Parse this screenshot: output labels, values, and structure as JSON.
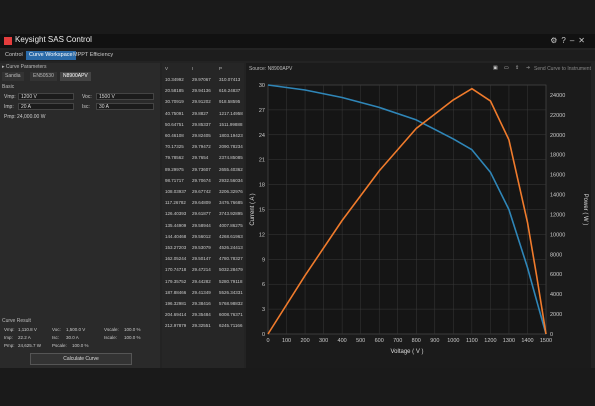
{
  "window": {
    "title": "Keysight SAS Control",
    "icons": [
      "gear-icon",
      "help-icon",
      "minimize-icon",
      "close-icon"
    ]
  },
  "tabs": [
    {
      "label": "Control",
      "active": false
    },
    {
      "label": "Curve Workspace",
      "active": true
    },
    {
      "label": "MPPT Efficiency",
      "active": false
    }
  ],
  "curve_params": {
    "section_label": "▸ Curve Parameters",
    "subtabs": [
      "Sandia",
      "EN50530",
      "N8900APV"
    ],
    "basic_label": "Basic",
    "vmp_label": "Vmp:",
    "vmp_value": "1200 V",
    "voc_label": "Voc:",
    "voc_value": "1500 V",
    "imp_label": "Imp:",
    "imp_value": "20 A",
    "isc_label": "Isc:",
    "isc_value": "30 A",
    "pmp_label": "Pmp: 24,000.00 W"
  },
  "curve_result": {
    "section_label": "Curve Result",
    "row1": [
      "Vmp:",
      "1,110.8 V",
      "Voc:",
      "1,500.0 V",
      "Vscale:",
      "100.0 %"
    ],
    "row2": [
      "Imp:",
      "22.2 A",
      "Isc:",
      "30.0 A",
      "Iscale:",
      "100.0 %"
    ],
    "row3": [
      "Pmp:",
      "24,625.7 W",
      "Pscale:",
      "100.0 %"
    ],
    "calculate_label": "Calculate Curve"
  },
  "table": {
    "headers": [
      "V",
      "I",
      "P"
    ],
    "rows": [
      [
        "10.34992",
        "29.97067",
        "310.07413"
      ],
      [
        "20.58185",
        "29.94136",
        "616.24837"
      ],
      [
        "30.70919",
        "29.91202",
        "918.58595"
      ],
      [
        "40.75091",
        "29.8827",
        "1217.14958"
      ],
      [
        "50.64751",
        "29.85337",
        "1511.99888"
      ],
      [
        "60.46108",
        "29.82405",
        "1803.19423"
      ],
      [
        "70.17325",
        "29.79472",
        "2090.78234"
      ],
      [
        "79.78562",
        "29.7654",
        "2374.85085"
      ],
      [
        "89.29975",
        "29.73607",
        "2655.40362"
      ],
      [
        "98.71717",
        "29.70674",
        "2932.56034"
      ],
      [
        "108.03937",
        "29.67742",
        "3206.32976"
      ],
      [
        "117.26782",
        "29.64809",
        "3476.76685"
      ],
      [
        "126.40393",
        "29.61877",
        "3743.92895"
      ],
      [
        "135.44909",
        "29.58944",
        "4007.86275"
      ],
      [
        "144.40468",
        "29.56012",
        "4268.61963"
      ],
      [
        "153.27203",
        "29.53079",
        "4526.24413"
      ],
      [
        "162.05244",
        "29.50147",
        "4780.78327"
      ],
      [
        "170.74718",
        "29.47214",
        "5032.28479"
      ],
      [
        "179.35752",
        "29.44282",
        "5280.79118"
      ],
      [
        "187.88466",
        "29.41349",
        "5526.34331"
      ],
      [
        "196.32981",
        "29.38416",
        "5768.98832"
      ],
      [
        "204.69414",
        "29.35484",
        "6008.76371"
      ],
      [
        "212.97879",
        "29.32551",
        "6245.71166"
      ]
    ]
  },
  "chart_toolbar": {
    "source_label": "Source: N8900APV",
    "send_label": "Send Curve to Instrument",
    "icons": [
      "save-icon",
      "folder-icon",
      "export-icon",
      "send-icon"
    ]
  },
  "chart_data": {
    "type": "line",
    "xlabel": "Voltage ( V )",
    "ylabel": "Current ( A )",
    "y2label": "Power ( W )",
    "xlim": [
      0,
      1500
    ],
    "ylim": [
      0,
      30
    ],
    "y2lim": [
      0,
      25000
    ],
    "xticks": [
      0,
      100,
      200,
      300,
      400,
      500,
      600,
      700,
      800,
      900,
      1000,
      1100,
      1200,
      1300,
      1400,
      1500
    ],
    "yticks": [
      0,
      3,
      6,
      9,
      12,
      15,
      18,
      21,
      24,
      27,
      30
    ],
    "y2ticks": [
      0,
      2000,
      4000,
      6000,
      8000,
      10000,
      12000,
      14000,
      16000,
      18000,
      20000,
      22000,
      24000
    ],
    "grid": true,
    "series": [
      {
        "axis": "left",
        "color": "#2f86b8",
        "x": [
          0,
          200,
          400,
          600,
          800,
          1000,
          1100,
          1200,
          1300,
          1400,
          1450,
          1500
        ],
        "y": [
          30,
          29.4,
          28.5,
          27.3,
          25.8,
          23.5,
          22.2,
          19.5,
          15,
          8,
          4,
          0
        ]
      },
      {
        "axis": "right",
        "color": "#f07b2c",
        "x": [
          0,
          200,
          400,
          600,
          800,
          1000,
          1100,
          1200,
          1300,
          1400,
          1450,
          1500
        ],
        "y": [
          0,
          5880,
          11400,
          16380,
          20640,
          23500,
          24625,
          23400,
          19500,
          11200,
          5800,
          0
        ]
      }
    ]
  }
}
